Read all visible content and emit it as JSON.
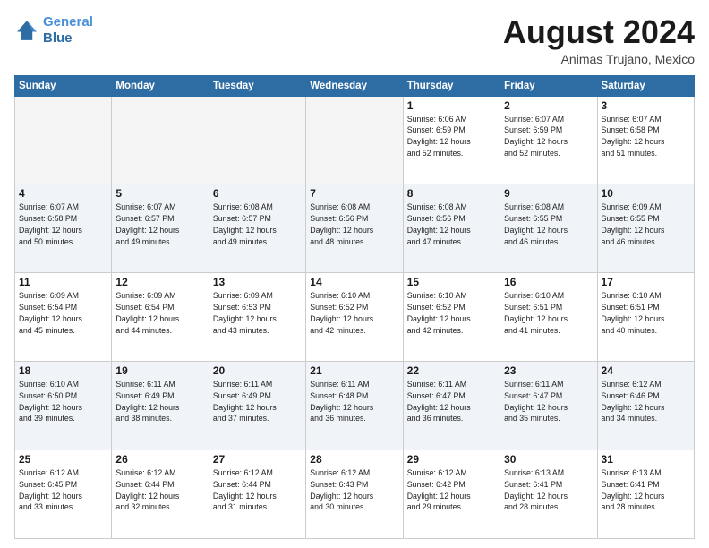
{
  "header": {
    "logo_line1": "General",
    "logo_line2": "Blue",
    "month": "August 2024",
    "location": "Animas Trujano, Mexico"
  },
  "weekdays": [
    "Sunday",
    "Monday",
    "Tuesday",
    "Wednesday",
    "Thursday",
    "Friday",
    "Saturday"
  ],
  "weeks": [
    [
      {
        "day": "",
        "info": ""
      },
      {
        "day": "",
        "info": ""
      },
      {
        "day": "",
        "info": ""
      },
      {
        "day": "",
        "info": ""
      },
      {
        "day": "1",
        "info": "Sunrise: 6:06 AM\nSunset: 6:59 PM\nDaylight: 12 hours\nand 52 minutes."
      },
      {
        "day": "2",
        "info": "Sunrise: 6:07 AM\nSunset: 6:59 PM\nDaylight: 12 hours\nand 52 minutes."
      },
      {
        "day": "3",
        "info": "Sunrise: 6:07 AM\nSunset: 6:58 PM\nDaylight: 12 hours\nand 51 minutes."
      }
    ],
    [
      {
        "day": "4",
        "info": "Sunrise: 6:07 AM\nSunset: 6:58 PM\nDaylight: 12 hours\nand 50 minutes."
      },
      {
        "day": "5",
        "info": "Sunrise: 6:07 AM\nSunset: 6:57 PM\nDaylight: 12 hours\nand 49 minutes."
      },
      {
        "day": "6",
        "info": "Sunrise: 6:08 AM\nSunset: 6:57 PM\nDaylight: 12 hours\nand 49 minutes."
      },
      {
        "day": "7",
        "info": "Sunrise: 6:08 AM\nSunset: 6:56 PM\nDaylight: 12 hours\nand 48 minutes."
      },
      {
        "day": "8",
        "info": "Sunrise: 6:08 AM\nSunset: 6:56 PM\nDaylight: 12 hours\nand 47 minutes."
      },
      {
        "day": "9",
        "info": "Sunrise: 6:08 AM\nSunset: 6:55 PM\nDaylight: 12 hours\nand 46 minutes."
      },
      {
        "day": "10",
        "info": "Sunrise: 6:09 AM\nSunset: 6:55 PM\nDaylight: 12 hours\nand 46 minutes."
      }
    ],
    [
      {
        "day": "11",
        "info": "Sunrise: 6:09 AM\nSunset: 6:54 PM\nDaylight: 12 hours\nand 45 minutes."
      },
      {
        "day": "12",
        "info": "Sunrise: 6:09 AM\nSunset: 6:54 PM\nDaylight: 12 hours\nand 44 minutes."
      },
      {
        "day": "13",
        "info": "Sunrise: 6:09 AM\nSunset: 6:53 PM\nDaylight: 12 hours\nand 43 minutes."
      },
      {
        "day": "14",
        "info": "Sunrise: 6:10 AM\nSunset: 6:52 PM\nDaylight: 12 hours\nand 42 minutes."
      },
      {
        "day": "15",
        "info": "Sunrise: 6:10 AM\nSunset: 6:52 PM\nDaylight: 12 hours\nand 42 minutes."
      },
      {
        "day": "16",
        "info": "Sunrise: 6:10 AM\nSunset: 6:51 PM\nDaylight: 12 hours\nand 41 minutes."
      },
      {
        "day": "17",
        "info": "Sunrise: 6:10 AM\nSunset: 6:51 PM\nDaylight: 12 hours\nand 40 minutes."
      }
    ],
    [
      {
        "day": "18",
        "info": "Sunrise: 6:10 AM\nSunset: 6:50 PM\nDaylight: 12 hours\nand 39 minutes."
      },
      {
        "day": "19",
        "info": "Sunrise: 6:11 AM\nSunset: 6:49 PM\nDaylight: 12 hours\nand 38 minutes."
      },
      {
        "day": "20",
        "info": "Sunrise: 6:11 AM\nSunset: 6:49 PM\nDaylight: 12 hours\nand 37 minutes."
      },
      {
        "day": "21",
        "info": "Sunrise: 6:11 AM\nSunset: 6:48 PM\nDaylight: 12 hours\nand 36 minutes."
      },
      {
        "day": "22",
        "info": "Sunrise: 6:11 AM\nSunset: 6:47 PM\nDaylight: 12 hours\nand 36 minutes."
      },
      {
        "day": "23",
        "info": "Sunrise: 6:11 AM\nSunset: 6:47 PM\nDaylight: 12 hours\nand 35 minutes."
      },
      {
        "day": "24",
        "info": "Sunrise: 6:12 AM\nSunset: 6:46 PM\nDaylight: 12 hours\nand 34 minutes."
      }
    ],
    [
      {
        "day": "25",
        "info": "Sunrise: 6:12 AM\nSunset: 6:45 PM\nDaylight: 12 hours\nand 33 minutes."
      },
      {
        "day": "26",
        "info": "Sunrise: 6:12 AM\nSunset: 6:44 PM\nDaylight: 12 hours\nand 32 minutes."
      },
      {
        "day": "27",
        "info": "Sunrise: 6:12 AM\nSunset: 6:44 PM\nDaylight: 12 hours\nand 31 minutes."
      },
      {
        "day": "28",
        "info": "Sunrise: 6:12 AM\nSunset: 6:43 PM\nDaylight: 12 hours\nand 30 minutes."
      },
      {
        "day": "29",
        "info": "Sunrise: 6:12 AM\nSunset: 6:42 PM\nDaylight: 12 hours\nand 29 minutes."
      },
      {
        "day": "30",
        "info": "Sunrise: 6:13 AM\nSunset: 6:41 PM\nDaylight: 12 hours\nand 28 minutes."
      },
      {
        "day": "31",
        "info": "Sunrise: 6:13 AM\nSunset: 6:41 PM\nDaylight: 12 hours\nand 28 minutes."
      }
    ]
  ]
}
